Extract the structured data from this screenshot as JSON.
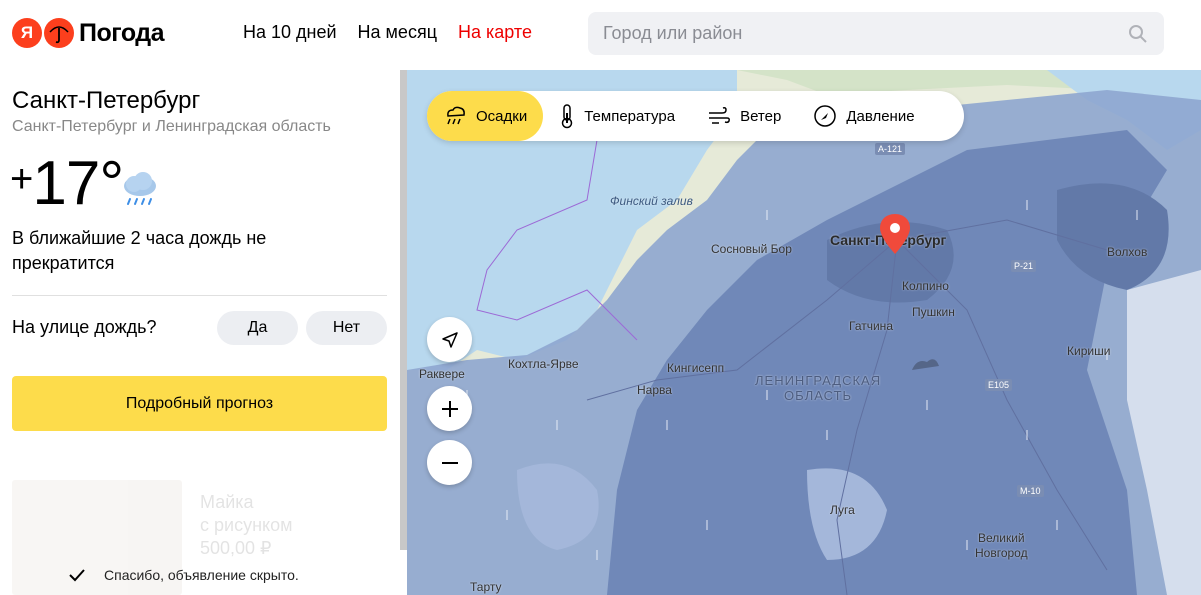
{
  "header": {
    "logo_letter": "Я",
    "logo_text": "Погода",
    "nav": [
      "На 10 дней",
      "На месяц",
      "На карте"
    ],
    "search_placeholder": "Город или район"
  },
  "location": {
    "city": "Санкт-Петербург",
    "region": "Санкт-Петербург и Ленинградская область"
  },
  "weather": {
    "temp_sign": "+",
    "temp_value": "17°",
    "condition_icon": "cloud-rain-icon",
    "nowcast": "В ближайшие 2 часа дождь не прекратится"
  },
  "feedback": {
    "question": "На улице дождь?",
    "yes": "Да",
    "no": "Нет"
  },
  "forecast_button": "Подробный прогноз",
  "ad": {
    "lines": [
      "Майка",
      "с рисунком",
      "500,00 ₽"
    ],
    "hidden_notice": "Спасибо, объявление скрыто."
  },
  "map": {
    "layers": [
      {
        "label": "Осадки",
        "icon": "precipitation-icon",
        "active": true
      },
      {
        "label": "Температура",
        "icon": "thermometer-icon",
        "active": false
      },
      {
        "label": "Ветер",
        "icon": "wind-icon",
        "active": false
      },
      {
        "label": "Давление",
        "icon": "pressure-icon",
        "active": false
      }
    ],
    "places": {
      "gulf": "Финский залив",
      "spb": "Санкт-Петербург",
      "sosnovy_bor": "Сосновый Бор",
      "kolpino": "Колпино",
      "pushkin": "Пушкин",
      "gatchina": "Гатчина",
      "volkhov": "Волхов",
      "kirishi": "Кириши",
      "rakvere": "Раквере",
      "kohtla": "Кохтла-Ярве",
      "kingisepp": "Кингисепп",
      "narva": "Нарва",
      "region_line1": "ЛЕНИНГРАДСКАЯ",
      "region_line2": "ОБЛАСТЬ",
      "luga": "Луга",
      "novgorod_line1": "Великий",
      "novgorod_line2": "Новгород",
      "tartu": "Тарту"
    },
    "roads": [
      "А-121",
      "Р-21",
      "Е105",
      "М-10"
    ],
    "colors": {
      "water": "#b8d8ee",
      "land": "#e8ecd9",
      "rain_light": "#8ea6cf",
      "rain_medium": "#7088b8",
      "accent": "#fddc4b",
      "pin": "#f04a3b"
    }
  }
}
